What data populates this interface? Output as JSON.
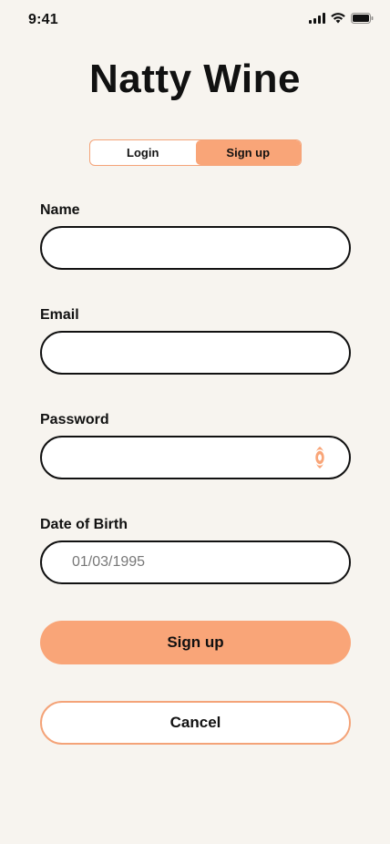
{
  "status_bar": {
    "time": "9:41",
    "icons": [
      "signal-icon",
      "wifi-icon",
      "battery-icon"
    ]
  },
  "app": {
    "title": "Natty Wine"
  },
  "auth_toggle": {
    "tabs": [
      {
        "label": "Login",
        "active": false
      },
      {
        "label": "Sign up",
        "active": true
      }
    ]
  },
  "form": {
    "name": {
      "label": "Name",
      "value": "",
      "placeholder": ""
    },
    "email": {
      "label": "Email",
      "value": "",
      "placeholder": ""
    },
    "password": {
      "label": "Password",
      "value": "",
      "placeholder": "",
      "toggle_icon": "eye-icon"
    },
    "dob": {
      "label": "Date of Birth",
      "value": "",
      "placeholder": "01/03/1995"
    }
  },
  "actions": {
    "submit_label": "Sign up",
    "cancel_label": "Cancel"
  },
  "colors": {
    "background": "#F7F4EF",
    "accent": "#F9A578",
    "text": "#111111"
  }
}
